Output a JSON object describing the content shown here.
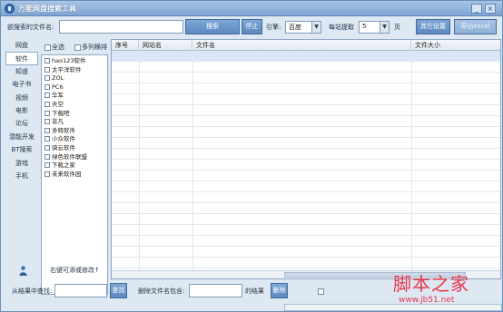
{
  "window": {
    "title": "万能网盘搜索工具",
    "min_glyph": "_",
    "close_glyph": "×"
  },
  "search": {
    "label": "欲搜索的文件名:",
    "value": "",
    "search_button": "搜索",
    "stop_button": "停止",
    "engine_label": "引擎:",
    "engine_value": "百度",
    "per_site_label": "每站提取",
    "per_site_value": "5",
    "page_unit": "页",
    "other_settings_button": "其它设置",
    "extra_button": "导出excel"
  },
  "categories": [
    "网盘",
    "软件",
    "知道",
    "电子书",
    "视频",
    "电影",
    "论坛",
    "潜能开发",
    "BT搜索",
    "游戏",
    "手机"
  ],
  "selected_category": "软件",
  "sites": {
    "select_all": "全选",
    "multi_column": "多列横排",
    "items": [
      "hao123软件",
      "太平洋软件",
      "ZOL",
      "PC6",
      "华军",
      "天空",
      "下载吧",
      "非凡",
      "多特软件",
      "小众软件",
      "骑云软件",
      "绿色软件联盟",
      "下载之家",
      "未来软件园"
    ],
    "footer": "右键可添或修改↑"
  },
  "grid": {
    "columns": [
      "序号",
      "网站名",
      "文件名",
      "文件大小"
    ]
  },
  "filter": {
    "find_label": "从结果中查找:",
    "find_value": "",
    "find_button": "查找",
    "delete_label": "删除文件名包含:",
    "delete_value": "",
    "delete_suffix": "的结果",
    "delete_button": "删除"
  },
  "watermark": {
    "text": "脚本之家",
    "url": "www.jb51.net"
  },
  "colors": {
    "title_bar": "#7fa4d2",
    "window_bg": "#dde8f3",
    "button": "#5c88c0",
    "selected_row": "#d8e6f7",
    "watermark": "#e8344a"
  }
}
